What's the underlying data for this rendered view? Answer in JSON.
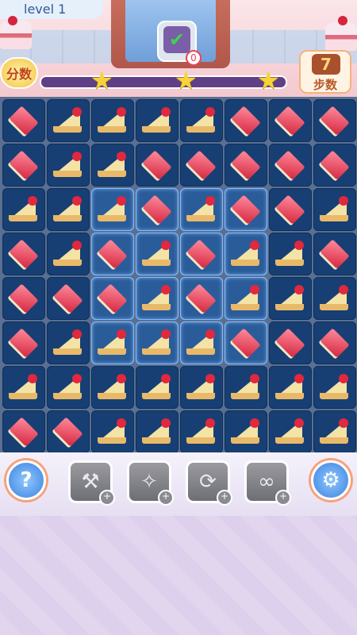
{
  "header": {
    "level_label": "level 1",
    "score_label": "分数",
    "target_count": "0",
    "moves_count": "7",
    "moves_label": "步数",
    "progress_fraction": 0.0,
    "stars_count": 3
  },
  "board": {
    "rows": [
      [
        "red",
        "slice",
        "slice",
        "slice",
        "slice",
        "red",
        "red",
        "red"
      ],
      [
        "red",
        "slice",
        "slice",
        "red",
        "red",
        "red",
        "red",
        "red"
      ],
      [
        "slice",
        "slice",
        "slice",
        "red",
        "slice",
        "red",
        "red",
        "slice"
      ],
      [
        "red",
        "slice",
        "red",
        "slice",
        "red",
        "slice",
        "slice",
        "red"
      ],
      [
        "red",
        "red",
        "red",
        "slice",
        "red",
        "slice",
        "slice",
        "slice"
      ],
      [
        "red",
        "slice",
        "slice",
        "slice",
        "slice",
        "red",
        "red",
        "red"
      ],
      [
        "slice",
        "slice",
        "slice",
        "slice",
        "slice",
        "slice",
        "slice",
        "slice"
      ],
      [
        "red",
        "red",
        "slice",
        "slice",
        "slice",
        "slice",
        "slice",
        "slice"
      ]
    ],
    "highlighted": [
      [
        2,
        2
      ],
      [
        2,
        3
      ],
      [
        2,
        4
      ],
      [
        2,
        5
      ],
      [
        3,
        2
      ],
      [
        3,
        3
      ],
      [
        3,
        4
      ],
      [
        3,
        5
      ],
      [
        4,
        2
      ],
      [
        4,
        3
      ],
      [
        4,
        4
      ],
      [
        4,
        5
      ],
      [
        5,
        2
      ],
      [
        5,
        3
      ],
      [
        5,
        4
      ],
      [
        5,
        5
      ]
    ]
  },
  "tools": {
    "help_symbol": "?",
    "settings_icon": "gear-icon",
    "items": [
      {
        "name": "hammer-icon",
        "symbol": "⚒"
      },
      {
        "name": "wand-icon",
        "symbol": "✧"
      },
      {
        "name": "shuffle-icon",
        "symbol": "⟳"
      },
      {
        "name": "infinity-icon",
        "symbol": "∞"
      }
    ],
    "plus_symbol": "+"
  }
}
